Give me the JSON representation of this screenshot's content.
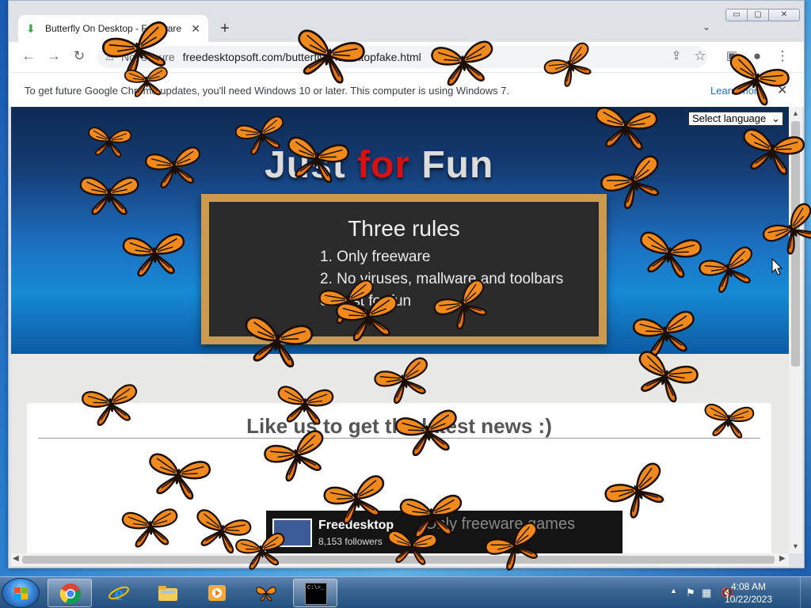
{
  "browser": {
    "tab_title": "Butterfly On Desktop - Freeware",
    "tab_close": "✕",
    "new_tab": "+",
    "tab_search": "⌄",
    "window": {
      "minimize": "▭",
      "maximize": "▢",
      "close": "✕"
    },
    "url_security": "Not secure",
    "url": "freedesktopsoft.com/butterflyondesktopfake.html",
    "infobar_text": "To get future Google Chrome updates, you'll need Windows 10 or later. This computer is using Windows 7.",
    "infobar_link": "Learn more",
    "infobar_close": "✕"
  },
  "page": {
    "language_select": "Select language",
    "logo": {
      "just": "Just ",
      "for": "for",
      "fun": " Fun"
    },
    "chalkboard": {
      "title": "Three rules",
      "rules": [
        "1. Only freeware",
        "2. No viruses, mallware and toolbars",
        "3. Just for fun"
      ]
    },
    "news_heading": "Like us to get the latest news :)",
    "facebook": {
      "name": "Freedesktop",
      "followers": "8,153 followers",
      "tagline": "Only freeware games"
    }
  },
  "taskbar": {
    "apps": [
      "chrome-icon",
      "ie-icon",
      "explorer-icon",
      "media-player-icon",
      "butterfly-icon",
      "cmd-icon"
    ],
    "cmd_label": "C:\\>_",
    "clock_time": "4:08 AM",
    "clock_date": "10/22/2023"
  },
  "colors": {
    "butterfly_orange": "#f08a1c",
    "butterfly_vein": "#1a0e06",
    "logo_red": "#d51111",
    "chalkboard_frame": "#c99a4f"
  }
}
